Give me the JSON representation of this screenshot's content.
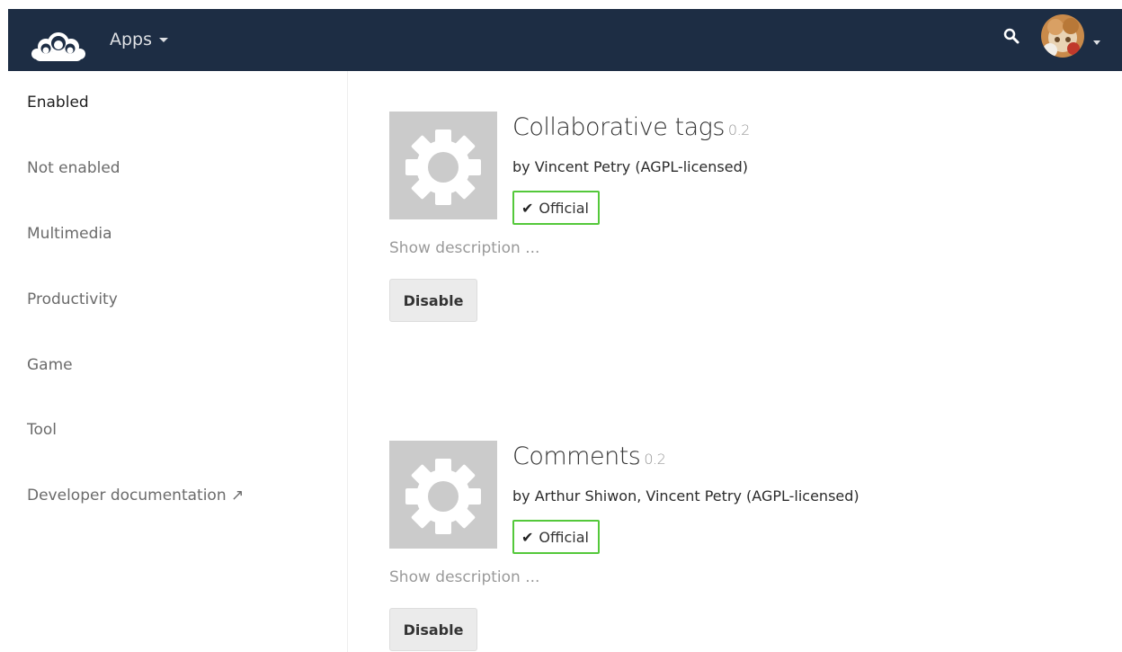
{
  "header": {
    "app_menu_label": "Apps",
    "background_color": "#1d2d44"
  },
  "sidebar": {
    "items": [
      {
        "label": "Enabled",
        "active": true
      },
      {
        "label": "Not enabled"
      },
      {
        "label": "Multimedia"
      },
      {
        "label": "Productivity"
      },
      {
        "label": "Game"
      },
      {
        "label": "Tool"
      },
      {
        "label": "Developer documentation ↗"
      }
    ]
  },
  "apps": [
    {
      "name": "Collaborative tags",
      "version": "0.2",
      "author": "by Vincent Petry (AGPL-licensed)",
      "badge": "Official",
      "show_description": "Show description ...",
      "action_label": "Disable"
    },
    {
      "name": "Comments",
      "version": "0.2",
      "author": "by Arthur Shiwon, Vincent Petry (AGPL-licensed)",
      "badge": "Official",
      "show_description": "Show description ...",
      "action_label": "Disable"
    }
  ],
  "icons": {
    "logo": "owncloud-logo-icon",
    "search": "search-icon",
    "app_icon": "gear-icon",
    "badge_check": "checkmark-icon"
  },
  "colors": {
    "official_badge_border": "#54c83a",
    "app_icon_bg": "#cbcbcb"
  }
}
